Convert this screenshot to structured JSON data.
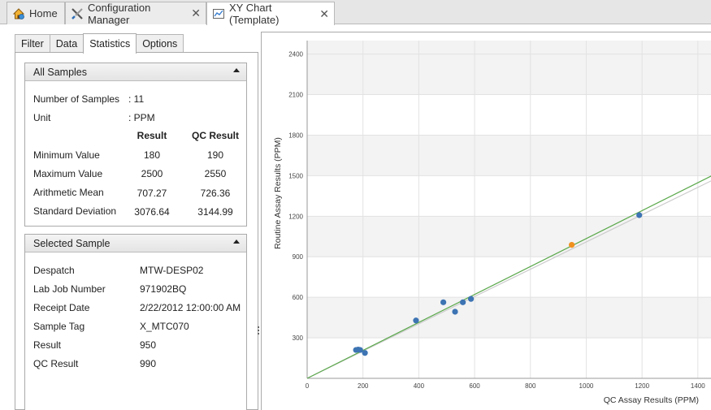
{
  "doc_tabs": [
    {
      "label": "Home",
      "icon": "home-icon"
    },
    {
      "label": "Configuration Manager",
      "icon": "tools-icon"
    },
    {
      "label": "XY Chart (Template)",
      "icon": "chart-icon"
    }
  ],
  "sub_tabs": [
    "Filter",
    "Data",
    "Statistics",
    "Options"
  ],
  "active_sub_tab": "Statistics",
  "all_samples": {
    "title": "All Samples",
    "number_of_samples_label": "Number of Samples",
    "number_of_samples_value": ": 11",
    "unit_label": "Unit",
    "unit_value": ": PPM",
    "col_result": "Result",
    "col_qc_result": "QC Result",
    "rows": [
      {
        "label": "Minimum Value",
        "result": "180",
        "qc": "190"
      },
      {
        "label": "Maximum Value",
        "result": "2500",
        "qc": "2550"
      },
      {
        "label": "Arithmetic Mean",
        "result": "707.27",
        "qc": "726.36"
      },
      {
        "label": "Standard Deviation",
        "result": "3076.64",
        "qc": "3144.99"
      }
    ]
  },
  "selected_sample": {
    "title": "Selected Sample",
    "rows": [
      {
        "label": "Despatch",
        "value": "MTW-DESP02"
      },
      {
        "label": "Lab Job Number",
        "value": "971902BQ"
      },
      {
        "label": "Receipt Date",
        "value": "2/22/2012 12:00:00 AM"
      },
      {
        "label": "Sample Tag",
        "value": "X_MTC070"
      },
      {
        "label": "Result",
        "value": "950"
      },
      {
        "label": "QC Result",
        "value": "990"
      }
    ]
  },
  "chart_data": {
    "type": "scatter",
    "xlabel": "QC Assay Results (PPM)",
    "ylabel": "Routine Assay Results (PPM)",
    "xlim": [
      0,
      1450
    ],
    "ylim": [
      0,
      2500
    ],
    "xticks": [
      0,
      200,
      400,
      600,
      800,
      1000,
      1200,
      1400
    ],
    "yticks": [
      0,
      300,
      600,
      900,
      1200,
      1500,
      1800,
      2100,
      2400
    ],
    "grid": true,
    "points": [
      {
        "x": 175,
        "y": 210,
        "color": "#3d74b3"
      },
      {
        "x": 183,
        "y": 213,
        "color": "#3d74b3"
      },
      {
        "x": 190,
        "y": 210,
        "color": "#3d74b3"
      },
      {
        "x": 207,
        "y": 188,
        "color": "#3d74b3"
      },
      {
        "x": 390,
        "y": 428,
        "color": "#3d74b3"
      },
      {
        "x": 488,
        "y": 563,
        "color": "#3d74b3"
      },
      {
        "x": 530,
        "y": 493,
        "color": "#3d74b3"
      },
      {
        "x": 558,
        "y": 563,
        "color": "#3d74b3"
      },
      {
        "x": 587,
        "y": 588,
        "color": "#3d74b3"
      },
      {
        "x": 948,
        "y": 988,
        "color": "#f0901e"
      },
      {
        "x": 1190,
        "y": 1208,
        "color": "#3d74b3"
      }
    ],
    "lines": [
      {
        "x": [
          0,
          1450
        ],
        "y": [
          0,
          1464
        ],
        "color": "#cccccc"
      },
      {
        "x": [
          0,
          1450
        ],
        "y": [
          0,
          1500
        ],
        "color": "#5aa84a"
      }
    ]
  }
}
